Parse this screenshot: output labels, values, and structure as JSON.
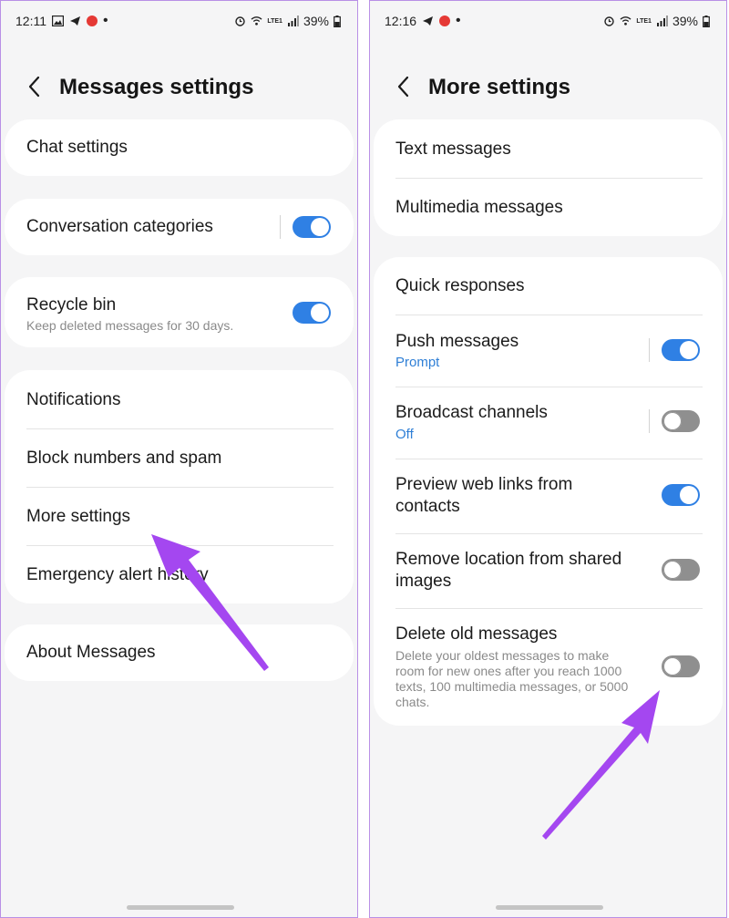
{
  "left": {
    "status": {
      "time": "12:11",
      "battery": "39%",
      "network": "LTE1"
    },
    "title": "Messages settings",
    "items": {
      "chat_settings": "Chat settings",
      "conversation_categories": "Conversation categories",
      "recycle_bin": "Recycle bin",
      "recycle_bin_sub": "Keep deleted messages for 30 days.",
      "notifications": "Notifications",
      "block_numbers": "Block numbers and spam",
      "more_settings": "More settings",
      "emergency_alert": "Emergency alert history",
      "about": "About Messages"
    }
  },
  "right": {
    "status": {
      "time": "12:16",
      "battery": "39%",
      "network": "LTE1"
    },
    "title": "More settings",
    "items": {
      "text_messages": "Text messages",
      "multimedia_messages": "Multimedia messages",
      "quick_responses": "Quick responses",
      "push_messages": "Push messages",
      "push_messages_sub": "Prompt",
      "broadcast_channels": "Broadcast channels",
      "broadcast_channels_sub": "Off",
      "preview_links_1": "Preview web links from",
      "preview_links_2": "contacts",
      "remove_location_1": "Remove location from shared",
      "remove_location_2": "images",
      "delete_old": "Delete old messages",
      "delete_old_sub_1": "Delete your oldest messages to make",
      "delete_old_sub_2": "room for new ones after you reach 1000",
      "delete_old_sub_3": "texts, 100 multimedia messages, or 5000",
      "delete_old_sub_4": "chats."
    }
  },
  "toggles": {
    "conversation_categories": true,
    "recycle_bin": true,
    "push_messages": true,
    "broadcast_channels": false,
    "preview_links": true,
    "remove_location": false,
    "delete_old": false
  },
  "colors": {
    "accent": "#2f80e4",
    "arrow": "#a447f0",
    "link": "#2f7fd6",
    "frame": "#b990e6"
  }
}
